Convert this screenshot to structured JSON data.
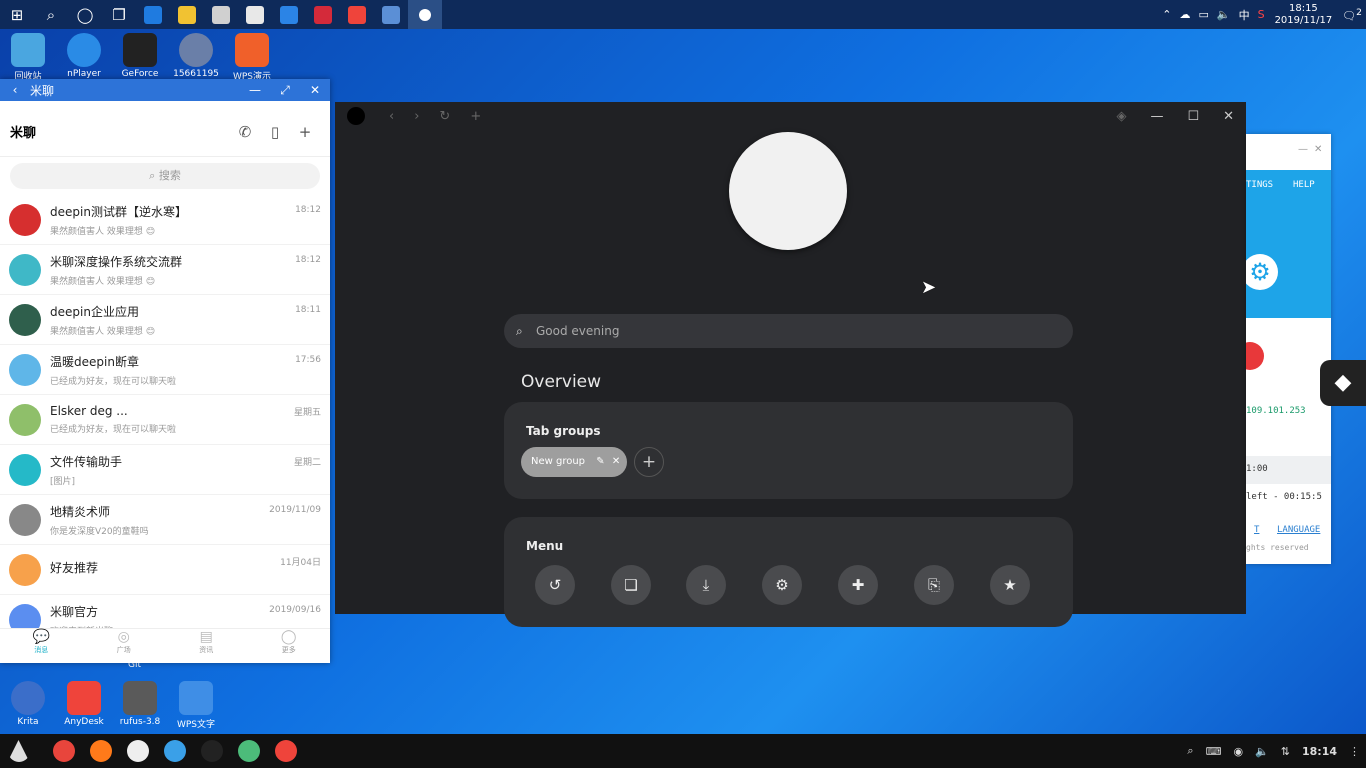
{
  "win_taskbar": {
    "clock_time": "18:15",
    "clock_date": "2019/11/17",
    "ime": "中",
    "notif_count": "2"
  },
  "desktop": {
    "top_icons": [
      {
        "label": "回收站",
        "color": "#4aa6e0"
      },
      {
        "label": "nPlayer",
        "color": "#2a8be6"
      },
      {
        "label": "GeForce",
        "color": "#222222"
      },
      {
        "label": "15661195",
        "color": "#6a7fa8"
      },
      {
        "label": "WPS演示",
        "color": "#f0602a"
      }
    ],
    "bottom_icons": [
      {
        "label": "Krita",
        "color": "#3b6ec9"
      },
      {
        "label": "AnyDesk",
        "color": "#ef443b"
      },
      {
        "label": "rufus-3.8",
        "color": "#5a5a5a"
      },
      {
        "label": "WPS文字",
        "color": "#3f8ee6"
      }
    ],
    "stray_label": "Git"
  },
  "chat": {
    "title": "米聊",
    "app_name": "米聊",
    "search_placeholder": "搜索",
    "conversations": [
      {
        "name": "deepin测试群【逆水寒】",
        "preview": "果然颜值害人 效果理想 😊",
        "time": "18:12",
        "color": "#d62f2f"
      },
      {
        "name": "米聊深度操作系统交流群",
        "preview": "果然颜值害人 效果理想 😊",
        "time": "18:12",
        "color": "#3fb8c7"
      },
      {
        "name": "deepin企业应用",
        "preview": "果然颜值害人 效果理想 😊",
        "time": "18:11",
        "color": "#2f5f4c"
      },
      {
        "name": "温暖deepin断章",
        "preview": "已经成为好友，现在可以聊天啦",
        "time": "17:56",
        "color": "#5fb6e8"
      },
      {
        "name": "Elsker deg ...",
        "preview": "已经成为好友，现在可以聊天啦",
        "time": "星期五",
        "color": "#8fbf6a"
      },
      {
        "name": "文件传输助手",
        "preview": "[图片]",
        "time": "星期二",
        "color": "#25b9c8"
      },
      {
        "name": "地精炎术师",
        "preview": "你是发深度V20的童鞋吗",
        "time": "2019/11/09",
        "color": "#888888"
      },
      {
        "name": "好友推荐",
        "preview": "",
        "time": "11月04日",
        "color": "#f7a14b"
      },
      {
        "name": "米聊官方",
        "preview": "欢迎来到新米聊",
        "time": "2019/09/16",
        "color": "#5b8ef0"
      }
    ],
    "nav": [
      {
        "label": "消息",
        "icon": "💬"
      },
      {
        "label": "广场",
        "icon": "◎"
      },
      {
        "label": "资讯",
        "icon": "▤"
      },
      {
        "label": "更多",
        "icon": "◯"
      }
    ]
  },
  "browser": {
    "search_placeholder": "Good evening",
    "overview_title": "Overview",
    "tab_groups_title": "Tab groups",
    "group_chip": "New group",
    "menu_title": "Menu",
    "menu_icons": [
      "history-icon",
      "bookmarks-icon",
      "downloads-icon",
      "settings-icon",
      "extensions-icon",
      "page-search-icon",
      "favorites-icon"
    ]
  },
  "right_app": {
    "menu_settings": "TINGS",
    "menu_help": "HELP",
    "ip_text": "109.101.253",
    "time_text": "1:00",
    "left_text": "left - 00:15:5",
    "link_language": "LANGUAGE",
    "link_t": "T",
    "rights_text": "ghts reserved"
  },
  "dock": {
    "apps": [
      {
        "name": "chrome",
        "color": "#e8453c"
      },
      {
        "name": "firefox",
        "color": "#ff7a1a"
      },
      {
        "name": "browser",
        "color": "#eeeeee"
      },
      {
        "name": "cloud",
        "color": "#3aa0e8"
      },
      {
        "name": "qq",
        "color": "#222222"
      },
      {
        "name": "miliao",
        "color": "#4cbc7a"
      },
      {
        "name": "anydesk",
        "color": "#ef443b"
      }
    ],
    "time": "18:14"
  }
}
